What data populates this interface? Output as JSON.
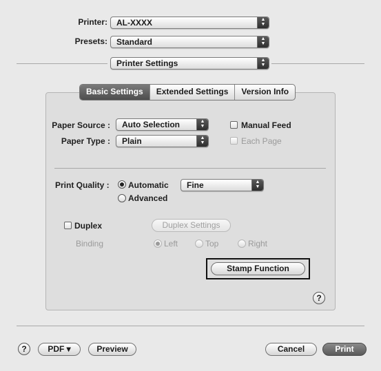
{
  "header": {
    "printer_label": "Printer:",
    "printer_value": "AL-XXXX",
    "presets_label": "Presets:",
    "presets_value": "Standard",
    "pane_value": "Printer Settings"
  },
  "tabs": [
    {
      "label": "Basic Settings",
      "active": true
    },
    {
      "label": "Extended Settings",
      "active": false
    },
    {
      "label": "Version Info",
      "active": false
    }
  ],
  "basic": {
    "paper_source_label": "Paper Source :",
    "paper_source_value": "Auto Selection",
    "paper_type_label": "Paper Type :",
    "paper_type_value": "Plain",
    "manual_feed_label": "Manual Feed",
    "manual_feed_checked": false,
    "each_page_label": "Each Page",
    "each_page_enabled": false,
    "print_quality_label": "Print Quality :",
    "automatic_label": "Automatic",
    "automatic_selected": true,
    "quality_value": "Fine",
    "advanced_label": "Advanced",
    "duplex_label": "Duplex",
    "duplex_checked": false,
    "duplex_settings_label": "Duplex Settings",
    "binding_label": "Binding",
    "binding_left": "Left",
    "binding_top": "Top",
    "binding_right": "Right",
    "binding_selected": "Left",
    "stamp_function_label": "Stamp Function",
    "help_glyph": "?"
  },
  "footer": {
    "help_glyph": "?",
    "pdf_label": "PDF ▾",
    "preview_label": "Preview",
    "cancel_label": "Cancel",
    "print_label": "Print"
  },
  "icons": {
    "popup_arrows": "up-down-arrows-icon"
  },
  "colors": {
    "window_bg": "#e9e9e9",
    "tab_active": "#5a5a5a",
    "default_button": "#6e6e6e"
  }
}
